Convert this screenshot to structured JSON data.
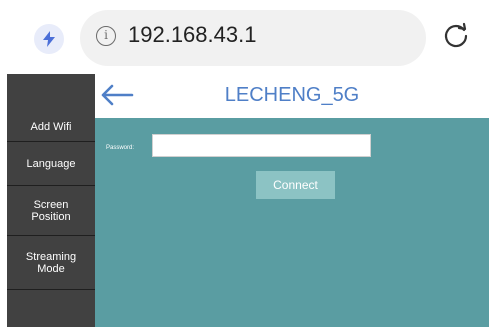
{
  "browser": {
    "url": "192.168.43.1",
    "info_glyph": "i",
    "icons": {
      "left": "bolt-shield-icon",
      "info": "info-icon",
      "reload": "reload-icon"
    }
  },
  "sidebar": {
    "items": [
      {
        "label": "Add Wifi"
      },
      {
        "label": "Language"
      },
      {
        "label": "Screen\nPosition"
      },
      {
        "label": "Streaming\nMode"
      }
    ]
  },
  "header": {
    "title": "LECHENG_5G",
    "back_icon": "arrow-left-icon"
  },
  "form": {
    "password_label": "Password:",
    "password_value": "",
    "connect_label": "Connect"
  },
  "colors": {
    "sidebar_bg": "#414141",
    "panel_bg": "#5a9da2",
    "button_bg": "#8cc3c4",
    "title_blue": "#4f7fc7",
    "shield_bolt": "#4b6fd8"
  }
}
